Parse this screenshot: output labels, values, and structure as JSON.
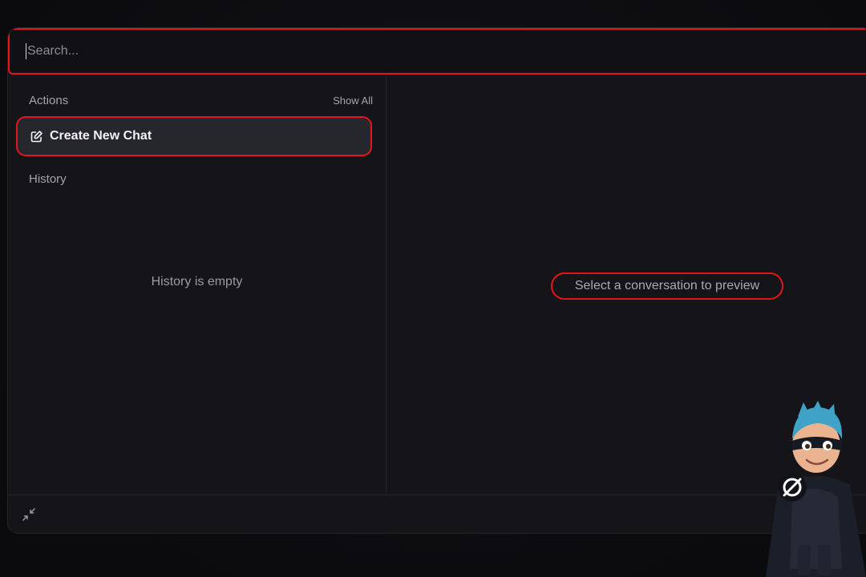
{
  "search": {
    "placeholder": "Search..."
  },
  "actions": {
    "title": "Actions",
    "show_all_label": "Show All",
    "create_new_chat_label": "Create New Chat",
    "create_new_chat_icon": "edit-icon"
  },
  "history": {
    "title": "History",
    "empty_text": "History is empty"
  },
  "preview": {
    "hint": "Select a conversation to preview"
  },
  "footer": {
    "collapse_icon": "collapse-icon"
  },
  "colors": {
    "highlight": "#e8141a",
    "background": "#141419",
    "accent_mascot_hair": "#3fa3c8"
  }
}
